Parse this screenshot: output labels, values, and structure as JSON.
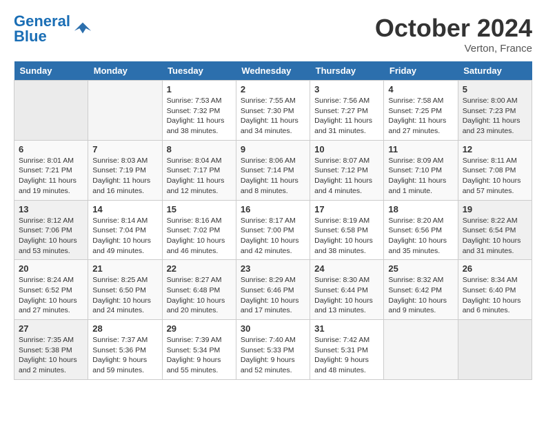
{
  "header": {
    "logo_text_general": "General",
    "logo_text_blue": "Blue",
    "month_title": "October 2024",
    "location": "Verton, France"
  },
  "days_of_week": [
    "Sunday",
    "Monday",
    "Tuesday",
    "Wednesday",
    "Thursday",
    "Friday",
    "Saturday"
  ],
  "weeks": [
    [
      {
        "num": "",
        "empty": true
      },
      {
        "num": "",
        "empty": true
      },
      {
        "num": "1",
        "sunrise": "Sunrise: 7:53 AM",
        "sunset": "Sunset: 7:32 PM",
        "daylight": "Daylight: 11 hours and 38 minutes."
      },
      {
        "num": "2",
        "sunrise": "Sunrise: 7:55 AM",
        "sunset": "Sunset: 7:30 PM",
        "daylight": "Daylight: 11 hours and 34 minutes."
      },
      {
        "num": "3",
        "sunrise": "Sunrise: 7:56 AM",
        "sunset": "Sunset: 7:27 PM",
        "daylight": "Daylight: 11 hours and 31 minutes."
      },
      {
        "num": "4",
        "sunrise": "Sunrise: 7:58 AM",
        "sunset": "Sunset: 7:25 PM",
        "daylight": "Daylight: 11 hours and 27 minutes."
      },
      {
        "num": "5",
        "sunrise": "Sunrise: 8:00 AM",
        "sunset": "Sunset: 7:23 PM",
        "daylight": "Daylight: 11 hours and 23 minutes."
      }
    ],
    [
      {
        "num": "6",
        "sunrise": "Sunrise: 8:01 AM",
        "sunset": "Sunset: 7:21 PM",
        "daylight": "Daylight: 11 hours and 19 minutes."
      },
      {
        "num": "7",
        "sunrise": "Sunrise: 8:03 AM",
        "sunset": "Sunset: 7:19 PM",
        "daylight": "Daylight: 11 hours and 16 minutes."
      },
      {
        "num": "8",
        "sunrise": "Sunrise: 8:04 AM",
        "sunset": "Sunset: 7:17 PM",
        "daylight": "Daylight: 11 hours and 12 minutes."
      },
      {
        "num": "9",
        "sunrise": "Sunrise: 8:06 AM",
        "sunset": "Sunset: 7:14 PM",
        "daylight": "Daylight: 11 hours and 8 minutes."
      },
      {
        "num": "10",
        "sunrise": "Sunrise: 8:07 AM",
        "sunset": "Sunset: 7:12 PM",
        "daylight": "Daylight: 11 hours and 4 minutes."
      },
      {
        "num": "11",
        "sunrise": "Sunrise: 8:09 AM",
        "sunset": "Sunset: 7:10 PM",
        "daylight": "Daylight: 11 hours and 1 minute."
      },
      {
        "num": "12",
        "sunrise": "Sunrise: 8:11 AM",
        "sunset": "Sunset: 7:08 PM",
        "daylight": "Daylight: 10 hours and 57 minutes."
      }
    ],
    [
      {
        "num": "13",
        "sunrise": "Sunrise: 8:12 AM",
        "sunset": "Sunset: 7:06 PM",
        "daylight": "Daylight: 10 hours and 53 minutes."
      },
      {
        "num": "14",
        "sunrise": "Sunrise: 8:14 AM",
        "sunset": "Sunset: 7:04 PM",
        "daylight": "Daylight: 10 hours and 49 minutes."
      },
      {
        "num": "15",
        "sunrise": "Sunrise: 8:16 AM",
        "sunset": "Sunset: 7:02 PM",
        "daylight": "Daylight: 10 hours and 46 minutes."
      },
      {
        "num": "16",
        "sunrise": "Sunrise: 8:17 AM",
        "sunset": "Sunset: 7:00 PM",
        "daylight": "Daylight: 10 hours and 42 minutes."
      },
      {
        "num": "17",
        "sunrise": "Sunrise: 8:19 AM",
        "sunset": "Sunset: 6:58 PM",
        "daylight": "Daylight: 10 hours and 38 minutes."
      },
      {
        "num": "18",
        "sunrise": "Sunrise: 8:20 AM",
        "sunset": "Sunset: 6:56 PM",
        "daylight": "Daylight: 10 hours and 35 minutes."
      },
      {
        "num": "19",
        "sunrise": "Sunrise: 8:22 AM",
        "sunset": "Sunset: 6:54 PM",
        "daylight": "Daylight: 10 hours and 31 minutes."
      }
    ],
    [
      {
        "num": "20",
        "sunrise": "Sunrise: 8:24 AM",
        "sunset": "Sunset: 6:52 PM",
        "daylight": "Daylight: 10 hours and 27 minutes."
      },
      {
        "num": "21",
        "sunrise": "Sunrise: 8:25 AM",
        "sunset": "Sunset: 6:50 PM",
        "daylight": "Daylight: 10 hours and 24 minutes."
      },
      {
        "num": "22",
        "sunrise": "Sunrise: 8:27 AM",
        "sunset": "Sunset: 6:48 PM",
        "daylight": "Daylight: 10 hours and 20 minutes."
      },
      {
        "num": "23",
        "sunrise": "Sunrise: 8:29 AM",
        "sunset": "Sunset: 6:46 PM",
        "daylight": "Daylight: 10 hours and 17 minutes."
      },
      {
        "num": "24",
        "sunrise": "Sunrise: 8:30 AM",
        "sunset": "Sunset: 6:44 PM",
        "daylight": "Daylight: 10 hours and 13 minutes."
      },
      {
        "num": "25",
        "sunrise": "Sunrise: 8:32 AM",
        "sunset": "Sunset: 6:42 PM",
        "daylight": "Daylight: 10 hours and 9 minutes."
      },
      {
        "num": "26",
        "sunrise": "Sunrise: 8:34 AM",
        "sunset": "Sunset: 6:40 PM",
        "daylight": "Daylight: 10 hours and 6 minutes."
      }
    ],
    [
      {
        "num": "27",
        "sunrise": "Sunrise: 7:35 AM",
        "sunset": "Sunset: 5:38 PM",
        "daylight": "Daylight: 10 hours and 2 minutes."
      },
      {
        "num": "28",
        "sunrise": "Sunrise: 7:37 AM",
        "sunset": "Sunset: 5:36 PM",
        "daylight": "Daylight: 9 hours and 59 minutes."
      },
      {
        "num": "29",
        "sunrise": "Sunrise: 7:39 AM",
        "sunset": "Sunset: 5:34 PM",
        "daylight": "Daylight: 9 hours and 55 minutes."
      },
      {
        "num": "30",
        "sunrise": "Sunrise: 7:40 AM",
        "sunset": "Sunset: 5:33 PM",
        "daylight": "Daylight: 9 hours and 52 minutes."
      },
      {
        "num": "31",
        "sunrise": "Sunrise: 7:42 AM",
        "sunset": "Sunset: 5:31 PM",
        "daylight": "Daylight: 9 hours and 48 minutes."
      },
      {
        "num": "",
        "empty": true
      },
      {
        "num": "",
        "empty": true
      }
    ]
  ]
}
